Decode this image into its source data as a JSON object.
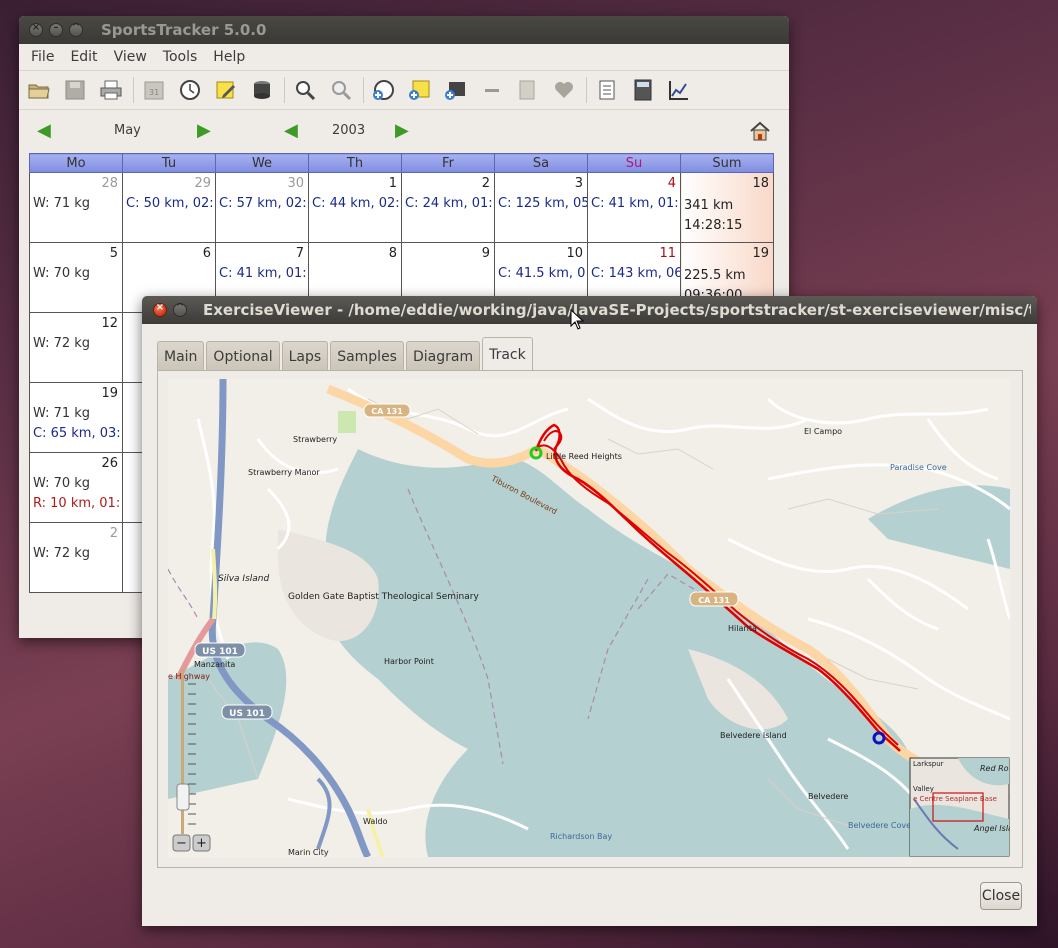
{
  "sportstracker": {
    "title": "SportsTracker 5.0.0",
    "menu": [
      "File",
      "Edit",
      "View",
      "Tools",
      "Help"
    ],
    "nav": {
      "month": "May",
      "year": "2003"
    },
    "calendar": {
      "headers": [
        "Mo",
        "Tu",
        "We",
        "Th",
        "Fr",
        "Sa",
        "Su",
        "Sum"
      ],
      "rows": [
        {
          "cells": [
            {
              "day": "28",
              "other": true,
              "e1": "W: 71 kg",
              "e1type": "w"
            },
            {
              "day": "29",
              "other": true,
              "e1": "C: 50 km, 02:"
            },
            {
              "day": "30",
              "other": true,
              "e1": "C: 57 km, 02:"
            },
            {
              "day": "1",
              "e1": "C: 44 km, 02:"
            },
            {
              "day": "2",
              "e1": "C: 24 km, 01:"
            },
            {
              "day": "3",
              "e1": "C: 125 km, 05"
            },
            {
              "day": "4",
              "red": true,
              "e1": "C: 41 km, 01:"
            }
          ],
          "sum": {
            "week": "18",
            "line1": "341 km",
            "line2": "14:28:15"
          }
        },
        {
          "cells": [
            {
              "day": "5",
              "e1": "W: 70 kg",
              "e1type": "w"
            },
            {
              "day": "6"
            },
            {
              "day": "7",
              "e1": "C: 41 km, 01:"
            },
            {
              "day": "8"
            },
            {
              "day": "9"
            },
            {
              "day": "10",
              "e1": "C: 41.5 km, 0"
            },
            {
              "day": "11",
              "red": true,
              "e1": "C: 143 km, 06"
            }
          ],
          "sum": {
            "week": "19",
            "line1": "225.5 km",
            "line2": "09:36:00"
          }
        },
        {
          "cells": [
            {
              "day": "12",
              "e1": "W: 72 kg",
              "e1type": "w"
            }
          ]
        },
        {
          "cells": [
            {
              "day": "19",
              "e1": "W: 71 kg",
              "e1type": "w",
              "e2": "C: 65 km, 03:"
            }
          ]
        },
        {
          "cells": [
            {
              "day": "26",
              "e1": "W: 70 kg",
              "e1type": "w",
              "e2": "R: 10 km, 01:",
              "e2type": "r"
            }
          ]
        },
        {
          "cells": [
            {
              "day": "2",
              "other": true,
              "e1": "W: 72 kg",
              "e1type": "w"
            }
          ]
        }
      ]
    }
  },
  "viewer": {
    "title": "ExerciseViewer - /home/eddie/working/java/JavaSE-Projects/sportstracker/st-exerciseviewer/misc/testdata/g",
    "tabs": [
      "Main",
      "Optional",
      "Laps",
      "Samples",
      "Diagram",
      "Track"
    ],
    "active_tab": "Track",
    "close_label": "Close",
    "map": {
      "labels": {
        "el_campo": "El Campo",
        "paradise_cove": "Paradise Cove",
        "little_reed": "Little Reed Heights",
        "strawberry": "Strawberry",
        "strawberry_manor": "Strawberry Manor",
        "silva_island": "Silva Island",
        "seminary": "Golden Gate Baptist Theological Seminary",
        "harbor_point": "Harbor Point",
        "manzanita": "Manzanita",
        "us101": "US 101",
        "ca131": "CA 131",
        "tiburon_blvd": "Tiburon Boulevard",
        "hilarita": "Hilarita",
        "belvedere_island": "Belvedere Island",
        "belvedere": "Belvedere",
        "belvedere_cove": "Belvedere Cove",
        "richardson_bay": "Richardson Bay",
        "waldo": "Waldo",
        "marin_city": "Marin City",
        "larkspur": "Larkspur",
        "red_rock": "Red Ro",
        "angel_island": "Angel Isla",
        "valley": "Valley",
        "highway": "e Highway",
        "seaplane": "e Centre Seaplane Base"
      },
      "zoom_minus": "−",
      "zoom_plus": "+",
      "colors": {
        "water": "#b5d0d0",
        "land": "#f2efe9",
        "track": "#e00000",
        "road": "#fcd6a4"
      }
    }
  }
}
